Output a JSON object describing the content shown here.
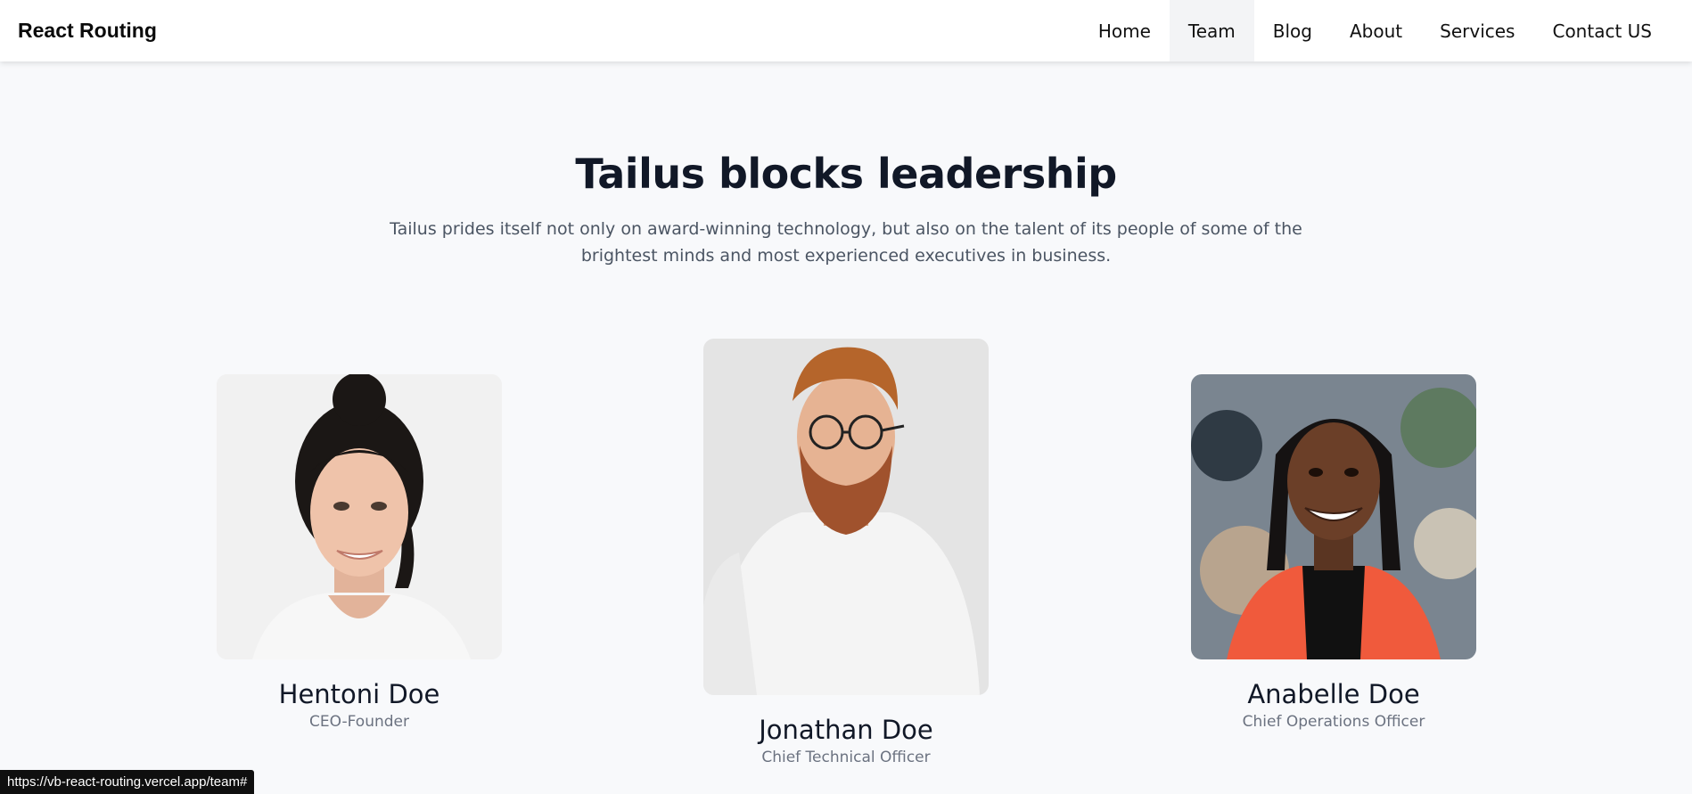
{
  "navbar": {
    "brand": "React Routing",
    "links": [
      {
        "label": "Home"
      },
      {
        "label": "Team",
        "active": true
      },
      {
        "label": "Blog"
      },
      {
        "label": "About"
      },
      {
        "label": "Services"
      },
      {
        "label": "Contact US"
      }
    ]
  },
  "hero": {
    "title": "Tailus blocks leadership",
    "description": "Tailus prides itself not only on award-winning technology, but also on the talent of its people of some of the brightest minds and most experienced executives in business."
  },
  "team": [
    {
      "name": "Hentoni Doe",
      "role": "CEO-Founder",
      "photo_icon": "woman-portrait-photo"
    },
    {
      "name": "Jonathan Doe",
      "role": "Chief Technical Officer",
      "photo_icon": "man-portrait-photo"
    },
    {
      "name": "Anabelle Doe",
      "role": "Chief Operations Officer",
      "photo_icon": "woman-portrait-photo"
    }
  ],
  "status_bar": {
    "url": "https://vb-react-routing.vercel.app/team#"
  },
  "colors": {
    "background": "#f8f9fb",
    "navbar": "#ffffff",
    "active_tab": "#f3f4f6",
    "title": "#111827",
    "body_text": "#4b5563",
    "role_text": "#6b7280"
  }
}
